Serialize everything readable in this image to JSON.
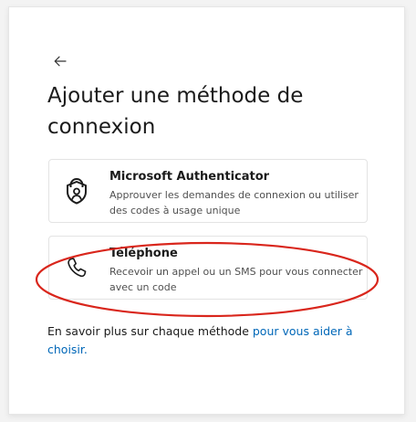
{
  "dialog": {
    "title": "Ajouter une méthode de connexion",
    "back_icon": "arrow-left-icon"
  },
  "methods": [
    {
      "icon": "lock-person-icon",
      "title": "Microsoft Authenticator",
      "description": "Approuver les demandes de connexion ou utiliser des codes à usage unique"
    },
    {
      "icon": "phone-icon",
      "title": "Téléphone",
      "description": "Recevoir un appel ou un SMS pour vous connecter avec un code"
    }
  ],
  "footer": {
    "text": "En savoir plus sur chaque méthode ",
    "link": "pour vous aider à choisir."
  },
  "colors": {
    "link": "#0067b8",
    "highlight": "#d9261c",
    "text": "#1b1b1b"
  }
}
